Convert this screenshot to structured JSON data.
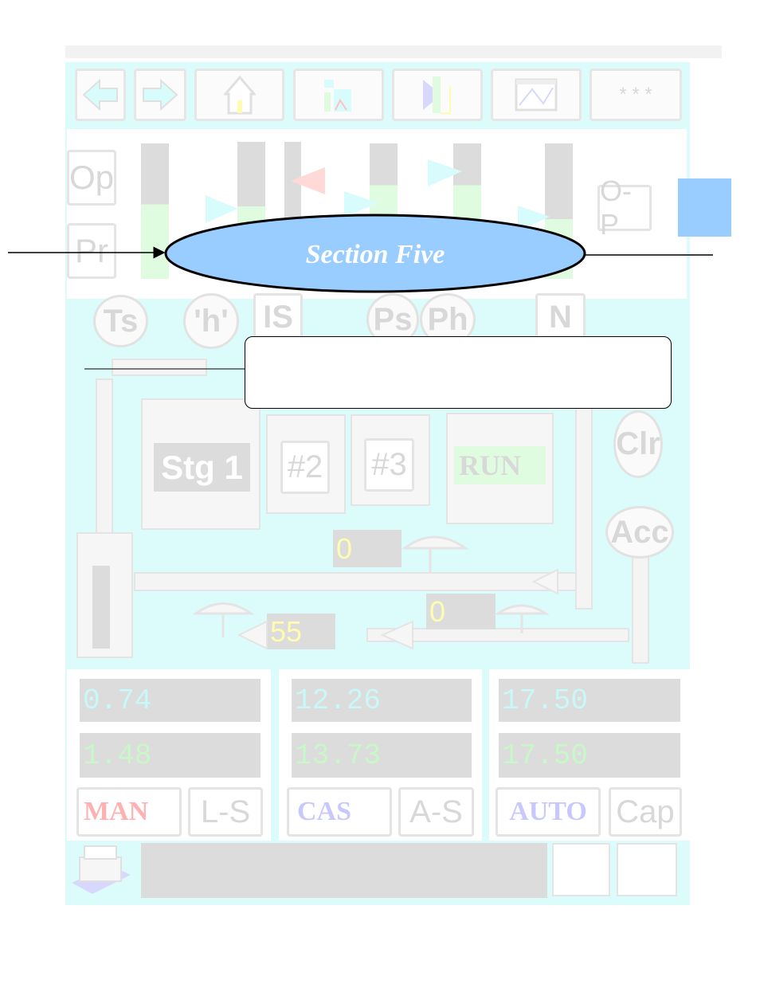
{
  "toolbar": {
    "buttons": [
      {
        "icon": "arrow-left-icon"
      },
      {
        "icon": "arrow-right-icon"
      },
      {
        "icon": "home-icon"
      },
      {
        "icon": "process-icon"
      },
      {
        "icon": "exit-door-icon"
      },
      {
        "icon": "trend-icon"
      },
      {
        "label": "* * *"
      }
    ]
  },
  "panel": {
    "op": "Op",
    "pr": "Pr",
    "op_p": "O-P"
  },
  "callout": {
    "title": "Section Five",
    "text": ""
  },
  "schematic": {
    "ts": "Ts",
    "h": "'h'",
    "is": "IS",
    "ps": "Ps",
    "ph": "Ph",
    "n": "N",
    "stage1": "Stg 1",
    "stage2": "#2",
    "stage3": "#3",
    "run": "RUN",
    "clr": "Clr",
    "acc": "Acc",
    "value_a": "0",
    "value_b": "0",
    "value_c": "55"
  },
  "controllers": [
    {
      "pv": "0.74",
      "sp": "1.48",
      "mode": "MAN",
      "mode_color": "#ffb0b0",
      "aux": "L-S"
    },
    {
      "pv": "12.26",
      "sp": "13.73",
      "mode": "CAS",
      "mode_color": "#c8c8ff",
      "aux": "A-S"
    },
    {
      "pv": "17.50",
      "sp": "17.50",
      "mode": "AUTO",
      "mode_color": "#c8c8ff",
      "aux": "Cap"
    }
  ],
  "colors": {
    "panel_bg": "#dcfcfc",
    "ellipse": "#99ccff",
    "pv_text": "#c8f8f8",
    "sp_text": "#c8f8c8",
    "display_text": "#fffbb0"
  }
}
